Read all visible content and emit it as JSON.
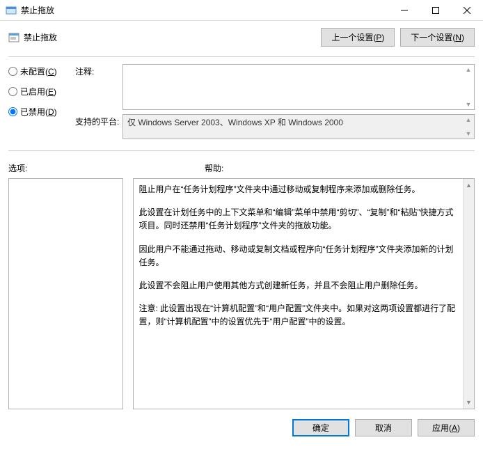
{
  "window": {
    "title": "禁止拖放"
  },
  "header": {
    "title": "禁止拖放",
    "prev_setting": "上一个设置(P)",
    "next_setting": "下一个设置(N)"
  },
  "radios": {
    "not_configured": "未配置(C)",
    "enabled": "已启用(E)",
    "disabled": "已禁用(D)",
    "selected": "disabled"
  },
  "fields": {
    "comment_label": "注释:",
    "comment_value": "",
    "platform_label": "支持的平台:",
    "platform_value": "仅 Windows Server 2003、Windows XP 和 Windows 2000"
  },
  "sections": {
    "options_label": "选项:",
    "help_label": "帮助:"
  },
  "help_paragraphs": {
    "p1": "阻止用户在“任务计划程序”文件夹中通过移动或复制程序来添加或删除任务。",
    "p2": "此设置在计划任务中的上下文菜单和“编辑”菜单中禁用“剪切”、“复制”和“粘贴”快捷方式项目。同时还禁用“任务计划程序”文件夹的拖放功能。",
    "p3": "因此用户不能通过拖动、移动或复制文档或程序向“任务计划程序”文件夹添加新的计划任务。",
    "p4": "此设置不会阻止用户使用其他方式创建新任务，并且不会阻止用户删除任务。",
    "p5": "注意: 此设置出现在“计算机配置”和“用户配置”文件夹中。如果对这两项设置都进行了配置，则“计算机配置”中的设置优先于“用户配置”中的设置。"
  },
  "footer": {
    "ok": "确定",
    "cancel": "取消",
    "apply": "应用(A)"
  }
}
